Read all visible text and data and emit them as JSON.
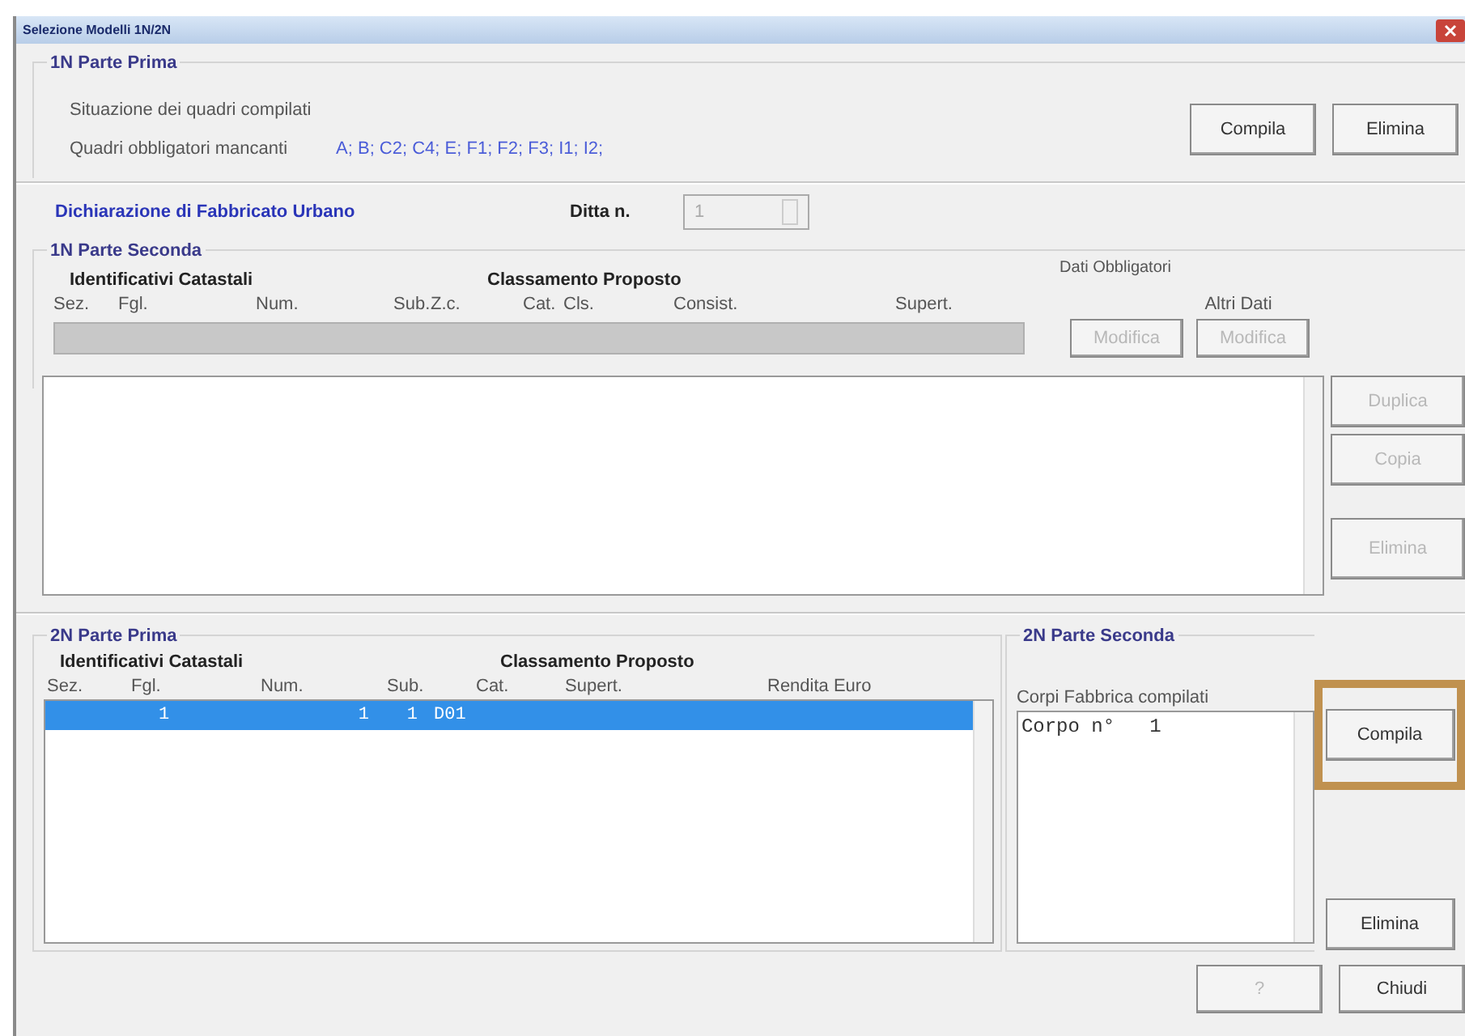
{
  "window": {
    "title": "Selezione Modelli 1N/2N"
  },
  "parte_prima_1n": {
    "title": "1N Parte Prima",
    "status_label": "Situazione dei quadri compilati",
    "missing_label": "Quadri obbligatori mancanti",
    "missing_value": "A; B; C2; C4; E; F1; F2; F3; I1; I2;",
    "buttons": [
      {
        "label": "Compila",
        "disabled": false
      },
      {
        "label": "Elimina",
        "disabled": false
      }
    ]
  },
  "declaration": {
    "title": "Dichiarazione di Fabbricato Urbano",
    "ditta_label": "Ditta n.",
    "ditta_value": "1",
    "ditta_disabled": true
  },
  "parte_seconda_1n": {
    "title": "1N Parte Seconda",
    "group_headers": [
      "Identificativi Catastali",
      "Classamento Proposto"
    ],
    "columns": [
      "Sez.",
      "Fgl.",
      "Num.",
      "Sub.",
      "Z.c.",
      "Cat.",
      "Cls.",
      "Consist.",
      "Supert."
    ],
    "dati_obbligatori_label": "Dati Obbligatori",
    "altri_dati_label": "Altri Dati",
    "edit_buttons": [
      {
        "label": "Modifica",
        "disabled": true
      },
      {
        "label": "Modifica",
        "disabled": true
      }
    ],
    "side_buttons": [
      {
        "label": "Duplica",
        "disabled": true
      },
      {
        "label": "Copia",
        "disabled": true
      },
      {
        "label": "Elimina",
        "disabled": true
      }
    ]
  },
  "parte_prima_2n": {
    "title": "2N Parte Prima",
    "group_headers": [
      "Identificativi Catastali",
      "Classamento Proposto"
    ],
    "columns": [
      "Sez.",
      "Fgl.",
      "Num.",
      "Sub.",
      "Cat.",
      "Supert.",
      "Rendita Euro"
    ],
    "rows": [
      {
        "cells": [
          "",
          "1",
          "1",
          "1",
          "D01",
          "",
          ""
        ],
        "selected": true
      }
    ]
  },
  "parte_seconda_2n": {
    "title": "2N Parte Seconda",
    "list_label": "Corpi Fabbrica compilati",
    "items": [
      "Corpo n°   1"
    ],
    "buttons": [
      {
        "label": "Compila",
        "disabled": false,
        "highlighted": true
      },
      {
        "label": "Elimina",
        "disabled": false,
        "highlighted": false
      }
    ]
  },
  "footer_buttons": [
    {
      "label": "?",
      "disabled": true
    },
    {
      "label": "Chiudi",
      "disabled": false
    }
  ]
}
